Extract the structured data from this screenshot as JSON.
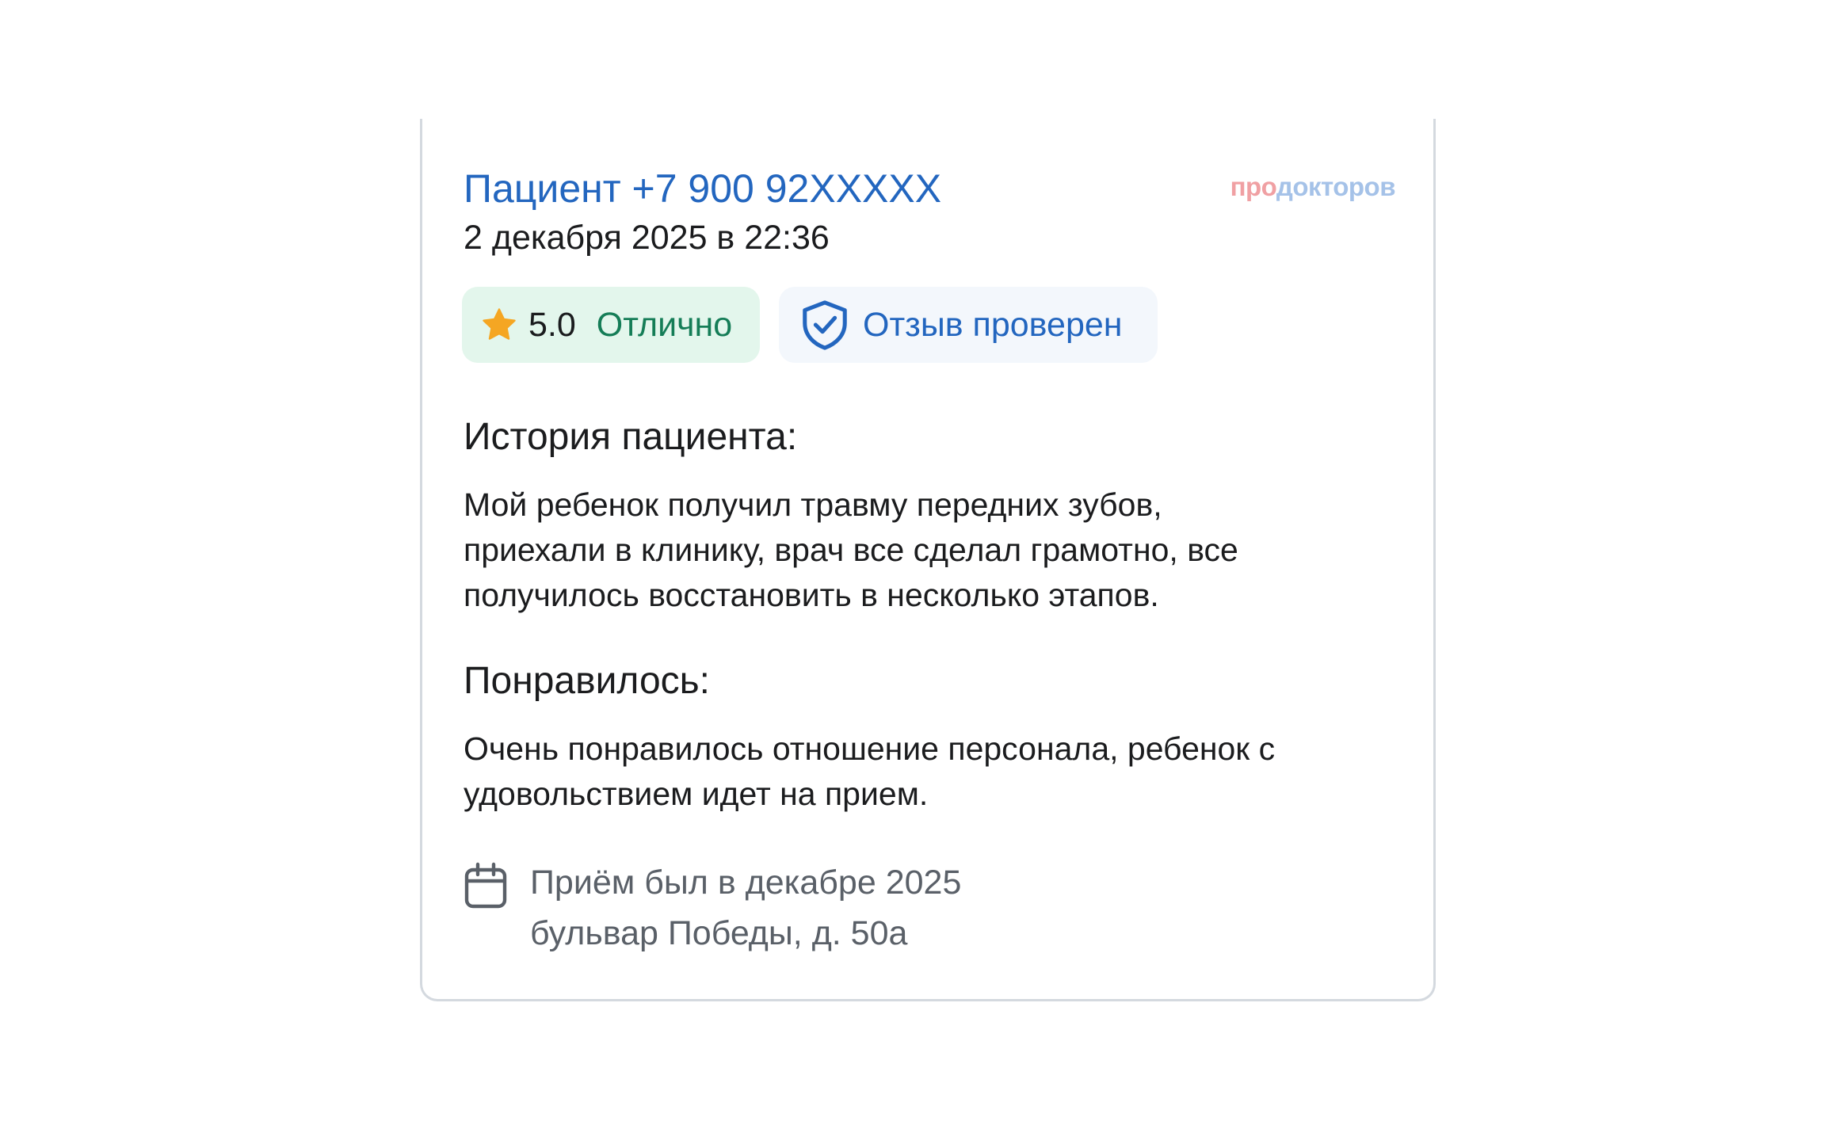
{
  "review": {
    "author": "Пациент +7 900 92XXXXX",
    "date": "2 декабря 2025 в 22:36",
    "logo": {
      "part1": "про",
      "part2": "докторов"
    },
    "rating": {
      "value": "5.0",
      "label": "Отлично",
      "icon": "star-icon"
    },
    "verified": {
      "label": "Отзыв проверен",
      "icon": "shield-check-icon"
    },
    "history": {
      "title": "История пациента:",
      "lines": [
        "Мой ребенок получил травму передних зубов,",
        "приехали в клинику, врач все сделал грамотно, все",
        "получилось восстановить в несколько этапов."
      ]
    },
    "liked": {
      "title": "Понравилось:",
      "lines": [
        "Очень понравилось отношение персонала, ребенок с",
        "удовольствием идет на прием."
      ]
    },
    "visit": {
      "icon": "calendar-icon",
      "when": "Приём был в декабре 2025",
      "address": "бульвар Победы, д. 50а"
    }
  },
  "colors": {
    "link": "#2366bf",
    "rating_bg": "#e3f6ec",
    "rating_text": "#157d57",
    "star": "#f5a623",
    "verified_bg": "#f3f7fc",
    "muted": "#5a6068",
    "logo_pro": "#f0a0a3",
    "logo_dok": "#a5c2e8"
  }
}
